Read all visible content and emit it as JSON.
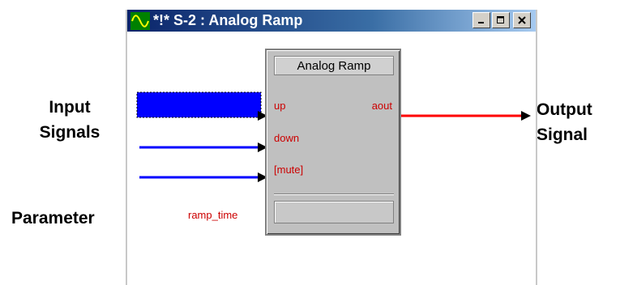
{
  "annotations": {
    "input_label": "Input Signals",
    "output_label": "Output Signal",
    "parameter_label": "Parameter"
  },
  "window": {
    "title": "*!* S-2 : Analog Ramp",
    "icon": "sine-wave-icon",
    "controls": [
      "minimize-icon",
      "maximize-icon",
      "close-icon"
    ]
  },
  "block": {
    "title": "Analog Ramp",
    "inputs": [
      "up",
      "down",
      "[mute]"
    ],
    "outputs": [
      "aout"
    ],
    "parameter": "ramp_time",
    "parameter_value": ""
  },
  "colors": {
    "input_wire": "#0000ff",
    "selected_wire": "#0000ff",
    "output_wire": "#ff0000",
    "pin_label": "#cc0000",
    "block_face": "#c0c0c0"
  },
  "state": {
    "selected_input": "up"
  }
}
